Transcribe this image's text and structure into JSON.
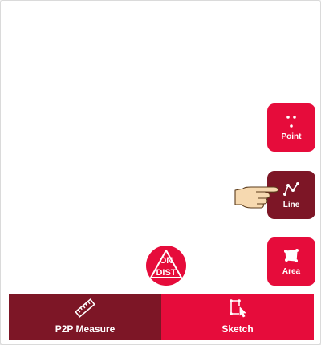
{
  "tools": {
    "point_label": "Point",
    "line_label": "Line",
    "area_label": "Area"
  },
  "ondist": {
    "top_text": "ON",
    "bottom_text": "DIST"
  },
  "bottom_bar": {
    "tabs": [
      {
        "label": "P2P Measure",
        "icon": "ruler-icon",
        "selected": true
      },
      {
        "label": "Sketch",
        "icon": "sketch-icon",
        "selected": false
      }
    ]
  },
  "colors": {
    "accent_red": "#e60c3b",
    "dark_red": "#7d1626",
    "background": "#ffffff"
  }
}
